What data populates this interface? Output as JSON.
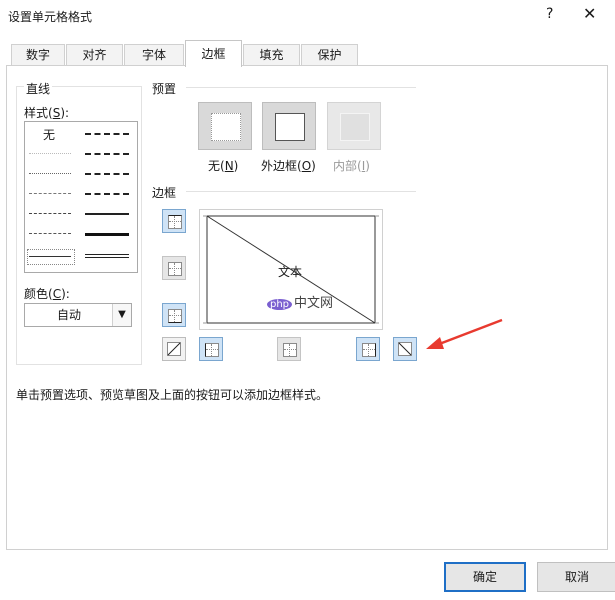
{
  "window": {
    "title": "设置单元格格式",
    "help": "?",
    "close": "✕"
  },
  "tabs": [
    "数字",
    "对齐",
    "字体",
    "边框",
    "填充",
    "保护"
  ],
  "line_group": {
    "title": "直线",
    "style_label": "样式(",
    "style_key": "S",
    "style_end": "):",
    "none_label": "无",
    "color_label": "颜色(",
    "color_key": "C",
    "color_end": "):",
    "color_value": "自动"
  },
  "presets": {
    "title": "预置",
    "none_label": "无(",
    "none_key": "N",
    "none_end": ")",
    "outline_label": "外边框(",
    "outline_key": "O",
    "outline_end": ")",
    "inside_label": "内部(",
    "inside_key": "I",
    "inside_end": ")"
  },
  "border": {
    "title": "边框",
    "preview_text": "文本"
  },
  "hint": "单击预置选项、预览草图及上面的按钮可以添加边框样式。",
  "watermark": {
    "logo": "php",
    "text": "中文网"
  },
  "buttons": {
    "ok": "确定",
    "cancel": "取消"
  },
  "colors": {
    "accent": "#1f6fc6",
    "arrow": "#e83a2f",
    "selected_button": "#cfe3f6"
  }
}
